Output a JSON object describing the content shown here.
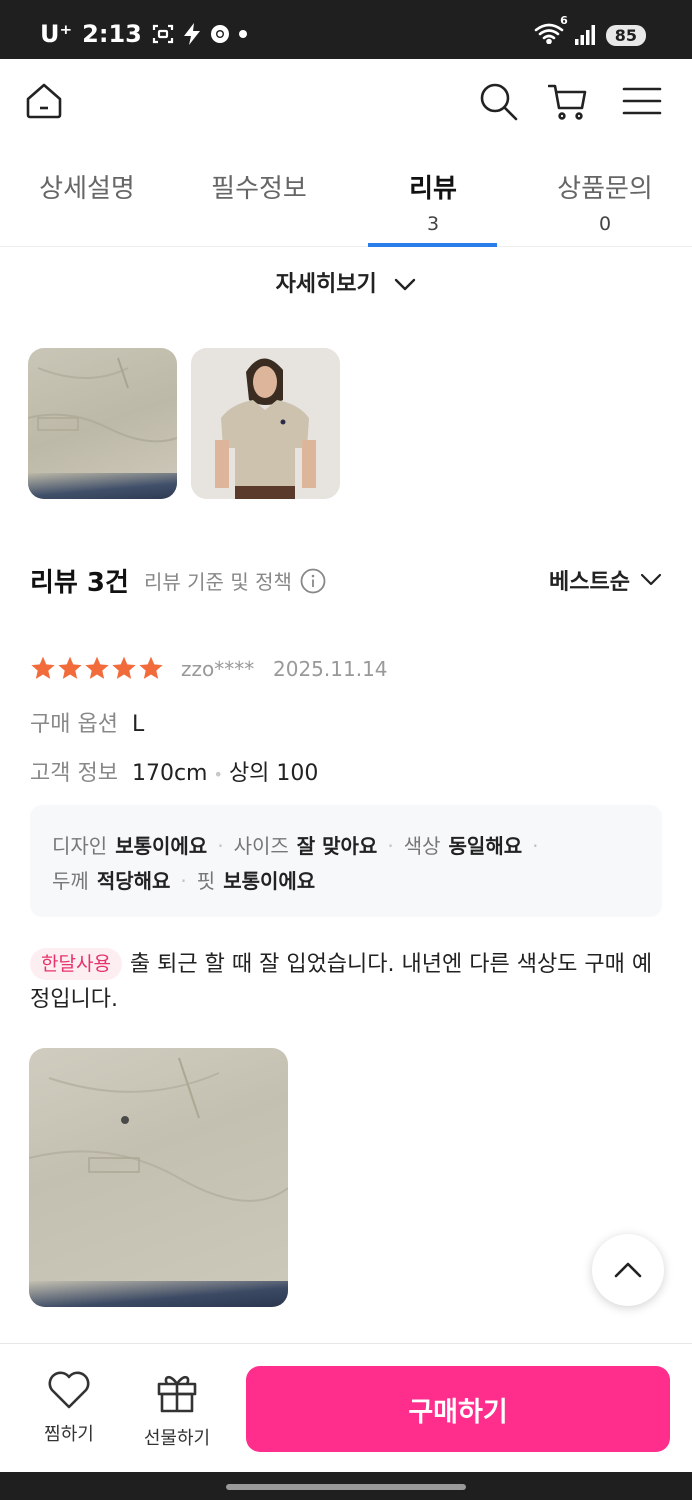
{
  "status_bar": {
    "carrier": "U⁺",
    "time": "2:13",
    "network_badge": "6",
    "battery": "85"
  },
  "top_nav": {
    "home_icon": "home-icon",
    "search_icon": "search-icon",
    "cart_icon": "cart-icon",
    "menu_icon": "menu-icon"
  },
  "tabs": [
    {
      "label": "상세설명",
      "count": ""
    },
    {
      "label": "필수정보",
      "count": ""
    },
    {
      "label": "리뷰",
      "count": "3"
    },
    {
      "label": "상품문의",
      "count": "0"
    }
  ],
  "active_tab_index": 2,
  "detail_toggle": {
    "label": "자세히보기"
  },
  "review_header": {
    "title": "리뷰 3건",
    "policy_link": "리뷰 기준 및 정책",
    "sort_label": "베스트순"
  },
  "review": {
    "rating": 5,
    "user": "zzo****",
    "date": "2025.11.14",
    "option_key": "구매 옵션",
    "option_value": "L",
    "customer_key": "고객 정보",
    "height": "170cm",
    "top_size": "상의 100",
    "evaluations": [
      {
        "key": "디자인",
        "value": "보통이에요"
      },
      {
        "key": "사이즈",
        "value": "잘 맞아요"
      },
      {
        "key": "색상",
        "value": "동일해요"
      },
      {
        "key": "두께",
        "value": "적당해요"
      },
      {
        "key": "핏",
        "value": "보통이에요"
      }
    ],
    "badge": "한달사용",
    "text": "출 퇴근 할 때 잘 입었습니다. 내년엔 다른 색상도 구매 예정입니다."
  },
  "bottom_bar": {
    "wish_label": "찜하기",
    "gift_label": "선물하기",
    "buy_label": "구매하기"
  },
  "colors": {
    "accent_pink": "#ff2d8c",
    "tab_indicator_blue": "#2b7de9",
    "star_orange": "#f26b3a",
    "badge_pink_text": "#e8336a"
  }
}
